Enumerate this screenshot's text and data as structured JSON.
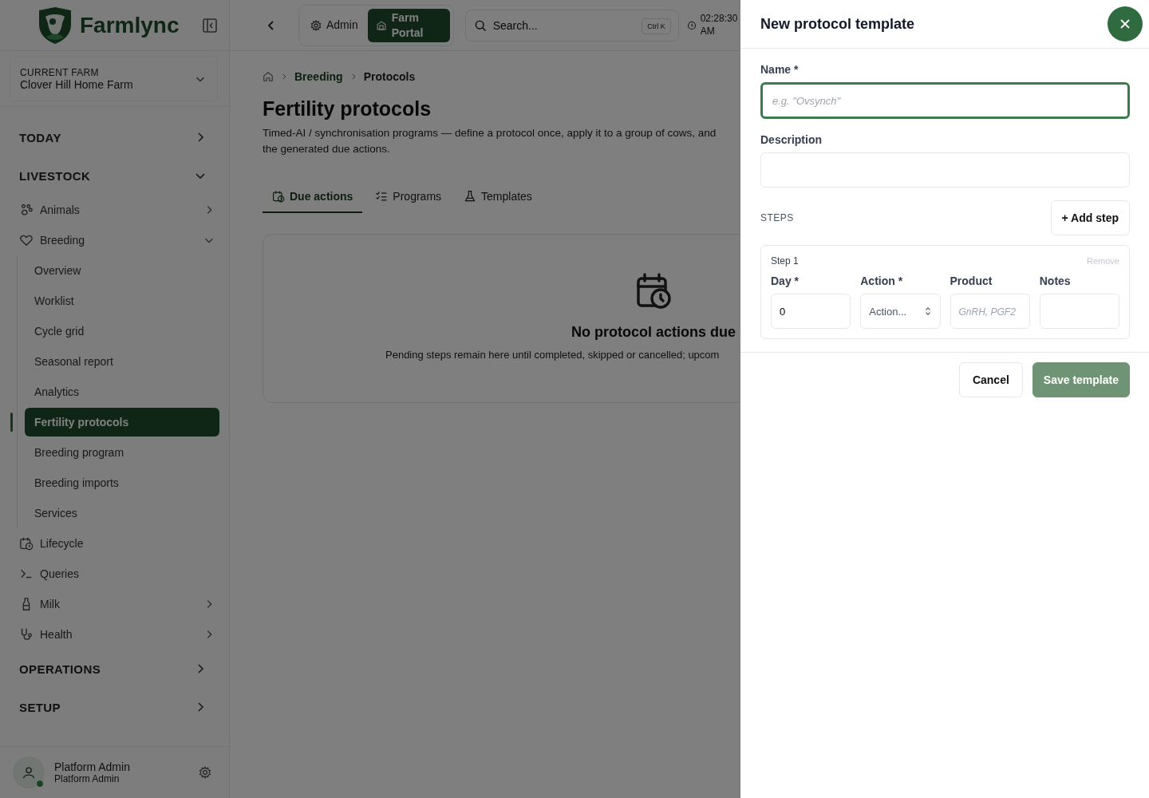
{
  "brand": {
    "name": "Farmlync"
  },
  "farm": {
    "caption": "CURRENT FARM",
    "name": "Clover Hill Home Farm"
  },
  "nav": [
    {
      "label": "TODAY",
      "expanded": false
    },
    {
      "label": "LIVESTOCK",
      "expanded": true,
      "children": [
        {
          "label": "Animals",
          "expanded": false
        },
        {
          "label": "Breeding",
          "expanded": true,
          "children": [
            {
              "label": "Overview",
              "selected": false
            },
            {
              "label": "Worklist",
              "selected": false
            },
            {
              "label": "Cycle grid",
              "selected": false
            },
            {
              "label": "Seasonal report",
              "selected": false
            },
            {
              "label": "Analytics",
              "selected": false
            },
            {
              "label": "Fertility protocols",
              "selected": true
            },
            {
              "label": "Breeding program",
              "selected": false
            },
            {
              "label": "Breeding imports",
              "selected": false
            },
            {
              "label": "Services",
              "selected": false
            }
          ]
        },
        {
          "label": "Lifecycle"
        },
        {
          "label": "Queries"
        },
        {
          "label": "Milk",
          "expanded": false
        },
        {
          "label": "Health",
          "expanded": false
        }
      ]
    },
    {
      "label": "OPERATIONS",
      "expanded": false
    },
    {
      "label": "SETUP",
      "expanded": false
    }
  ],
  "user": {
    "name": "Platform Admin",
    "role": "Platform Admin",
    "online": true
  },
  "topbar": {
    "portals": [
      {
        "label": "Admin",
        "selected": false
      },
      {
        "label": "Farm Portal",
        "selected": true
      }
    ],
    "search": {
      "placeholder": "Search...",
      "shortcut": "Ctrl K"
    },
    "time": "02:28:30 AM"
  },
  "breadcrumb": [
    "Breeding",
    "Protocols"
  ],
  "page": {
    "title": "Fertility protocols",
    "description": [
      "Timed-AI / synchronisation programs — define a protocol once, apply it to a group of cows, and",
      "the generated due actions."
    ]
  },
  "tabs": [
    {
      "label": "Due actions",
      "selected": true
    },
    {
      "label": "Programs",
      "selected": false
    },
    {
      "label": "Templates",
      "selected": false
    }
  ],
  "empty_state": {
    "title": "No protocol actions due",
    "text": "Pending steps remain here until completed, skipped or cancelled; upcom"
  },
  "drawer": {
    "title": "New protocol template",
    "fields": [
      {
        "label": "Name *",
        "placeholder": "e.g. \"Ovsynch\"",
        "focused": true
      },
      {
        "label": "Description",
        "focused": false
      }
    ],
    "steps_label": "STEPS",
    "add_step": "+ Add step",
    "steps": [
      {
        "title": "Step 1",
        "remove": "Remove",
        "fields": [
          {
            "kind": "input",
            "label": "Day *",
            "value": "0"
          },
          {
            "kind": "select",
            "label": "Action *",
            "value": "Action..."
          },
          {
            "kind": "input",
            "label": "Product",
            "placeholder": "GnRH, PGF2"
          },
          {
            "kind": "input",
            "label": "Notes"
          }
        ]
      }
    ],
    "buttons": [
      {
        "kind": "secondary",
        "label": "Cancel",
        "disabled": false
      },
      {
        "kind": "primary",
        "label": "Save template",
        "disabled": true
      }
    ]
  }
}
